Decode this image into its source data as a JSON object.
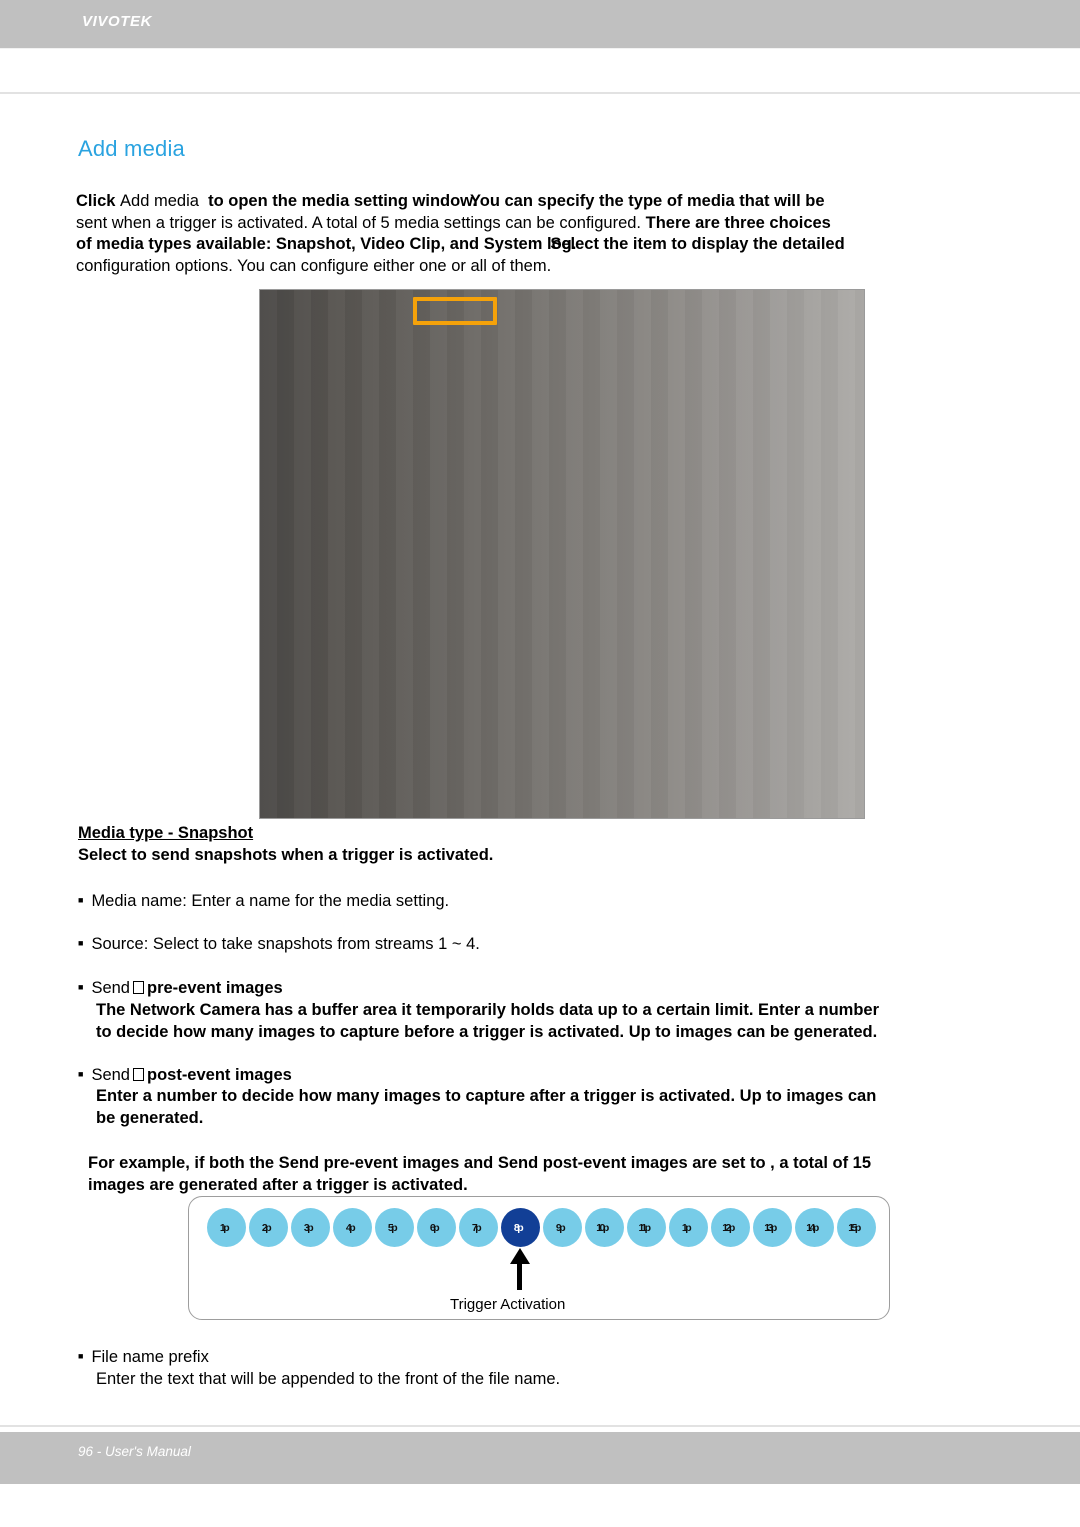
{
  "header": {
    "brand": "VIVOTEK"
  },
  "section": {
    "title": "Add media"
  },
  "intro": {
    "line1_a": "Click",
    "line1_b": "Add media",
    "line1_c": "to open the media setting window.",
    "line1_d": "You can specify the type of media that will be",
    "line2_a": "sent when a trigger is activated. A total of 5 media settings can be configured.",
    "line2_b": "There are three choices",
    "line3_a": "of media types available: Snapshot, Video Clip, and System log.",
    "line3_b": "Select the item to display the detailed",
    "line4": "configuration options. You can configure either one or all of them."
  },
  "media_type": {
    "heading": "Media type - Snapshot",
    "subheading": "Select to send snapshots when a trigger is activated.",
    "bullet_media_name": "Media name: Enter a name for the media setting.",
    "bullet_source": "Source: Select to take snapshots from streams 1 ~ 4."
  },
  "pre_event": {
    "label_a": "Send",
    "label_b": "pre-event images",
    "desc_line1": "The Network Camera has a buffer area it temporarily holds data up to a certain limit. Enter a number",
    "desc_line2": "to decide how many images to capture before a trigger is activated. Up to  images can be generated."
  },
  "post_event": {
    "label_a": "Send",
    "label_b": "post-event images",
    "desc_line1": "Enter a number to decide how many images to capture after a trigger is activated. Up to  images can",
    "desc_line2": "be generated."
  },
  "example": {
    "line1": "For example, if both the Send pre-event images and Send post-event images are set to , a total of 15",
    "line2": "images are generated after a trigger is activated."
  },
  "diagram": {
    "frames": [
      {
        "label": "1p",
        "trigger": false
      },
      {
        "label": "2p",
        "trigger": false
      },
      {
        "label": "3p",
        "trigger": false
      },
      {
        "label": "4p",
        "trigger": false
      },
      {
        "label": "5p",
        "trigger": false
      },
      {
        "label": "6p",
        "trigger": false
      },
      {
        "label": "7p",
        "trigger": false
      },
      {
        "label": "8p",
        "trigger": true
      },
      {
        "label": "9p",
        "trigger": false
      },
      {
        "label": "10p",
        "trigger": false
      },
      {
        "label": "11p",
        "trigger": false
      },
      {
        "label": "1p",
        "trigger": false
      },
      {
        "label": "12p",
        "trigger": false
      },
      {
        "label": "13p",
        "trigger": false
      },
      {
        "label": "14p",
        "trigger": false
      },
      {
        "label": "15p",
        "trigger": false
      }
    ],
    "trigger_label": "Trigger Activation",
    "frame_color": "#77cce8",
    "trigger_color": "#123f96"
  },
  "file_prefix": {
    "bullet": "File name prefix",
    "desc": "Enter the text that will be appended to the front of the file name."
  },
  "footer": {
    "text": "96 - User's Manual"
  },
  "colors": {
    "header_bg": "#c0c0c0",
    "accent_blue": "#2aa3e0",
    "highlight_orange": "#f5a20a"
  }
}
